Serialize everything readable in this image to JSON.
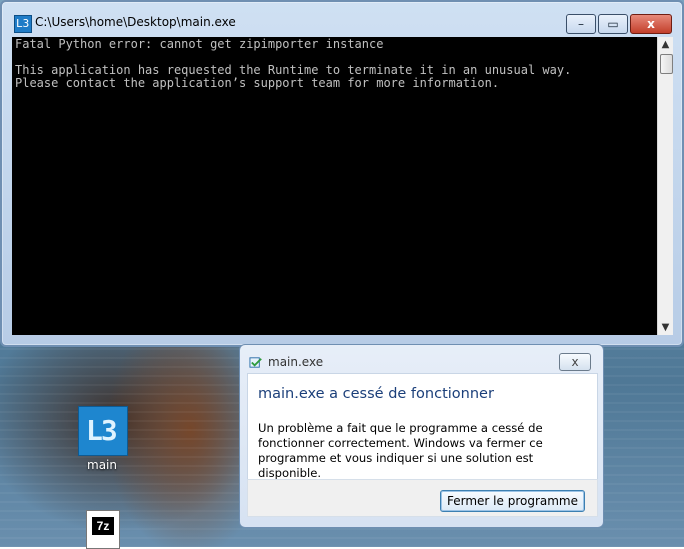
{
  "console": {
    "title": "C:\\Users\\home\\Desktop\\main.exe",
    "app_icon_text": "L3",
    "lines": "Fatal Python error: cannot get zipimporter instance\n\nThis application has requested the Runtime to terminate it in an unusual way.\nPlease contact the application’s support team for more information."
  },
  "window_buttons": {
    "minimize": "–",
    "maximize": "▭",
    "close": "x"
  },
  "desktop": {
    "icons": [
      {
        "label": "main",
        "glyph": "L3"
      },
      {
        "label": "",
        "glyph": "7z"
      }
    ]
  },
  "dialog": {
    "title": "main.exe",
    "heading": "main.exe a cessé de fonctionner",
    "body": "Un problème a fait que le programme a cessé de fonctionner correctement. Windows va fermer ce programme et vous indiquer si une solution est disponible.",
    "button_label": "Fermer le programme",
    "close_glyph": "x"
  },
  "colors": {
    "console_background": "#000000",
    "console_text": "#c0c0c0",
    "dialog_heading": "#1b3f7a",
    "button_border": "#3c7fb1"
  }
}
